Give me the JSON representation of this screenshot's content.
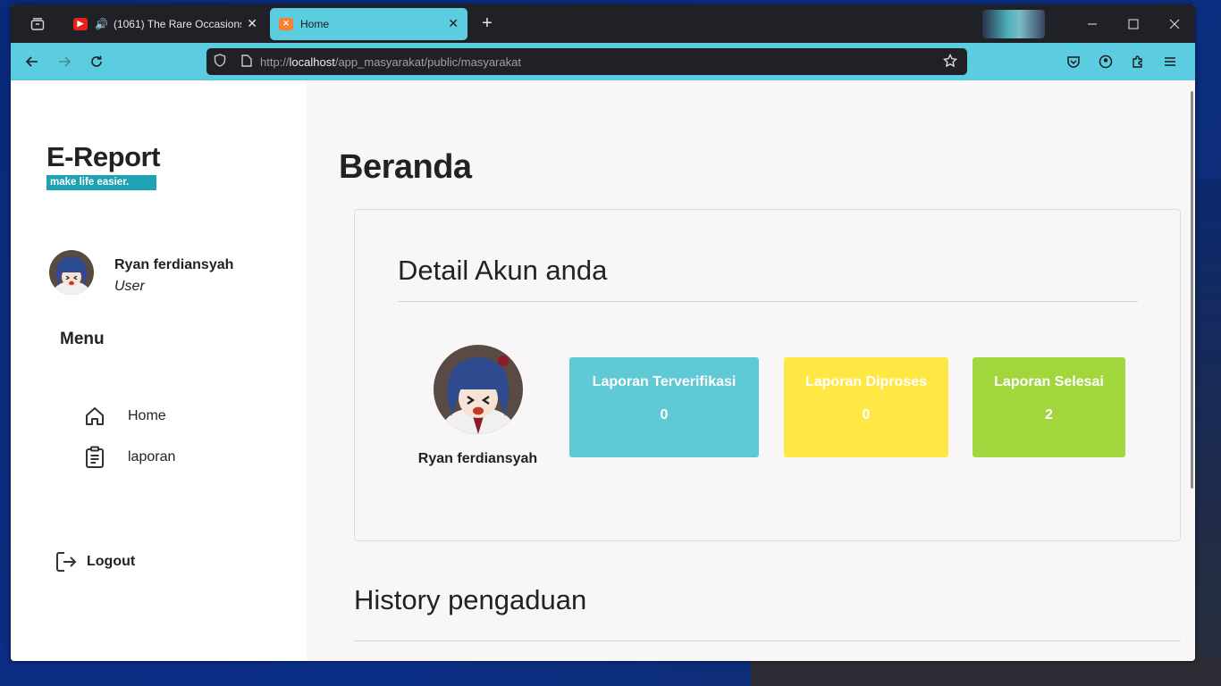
{
  "browser": {
    "tabs": [
      {
        "label": "(1061) The Rare Occasions |",
        "icon": "youtube-icon",
        "audio": true,
        "active": false
      },
      {
        "label": "Home",
        "icon": "xampp-icon",
        "active": true
      }
    ],
    "url": {
      "scheme": "http://",
      "host": "localhost",
      "path": "/app_masyarakat/public/masyarakat"
    },
    "accent_color": "#5ccde0"
  },
  "sidebar": {
    "brand": "E-Report",
    "tagline": "make life easier.",
    "user": {
      "name": "Ryan ferdiansyah",
      "role": "User"
    },
    "menu_title": "Menu",
    "menu_items": [
      {
        "label": "Home",
        "icon": "home-icon"
      },
      {
        "label": "laporan",
        "icon": "clipboard-icon"
      }
    ],
    "logout_label": "Logout"
  },
  "main": {
    "page_title": "Beranda",
    "account_card": {
      "title": "Detail Akun anda",
      "profile_name": "Ryan ferdiansyah",
      "stats": [
        {
          "label": "Laporan Terverifikasi",
          "value": "0",
          "color": "#5fcad6"
        },
        {
          "label": "Laporan Diproses",
          "value": "0",
          "color": "#ffe844"
        },
        {
          "label": "Laporan Selesai",
          "value": "2",
          "color": "#a1d63c"
        }
      ]
    },
    "history_title": "History pengaduan"
  }
}
